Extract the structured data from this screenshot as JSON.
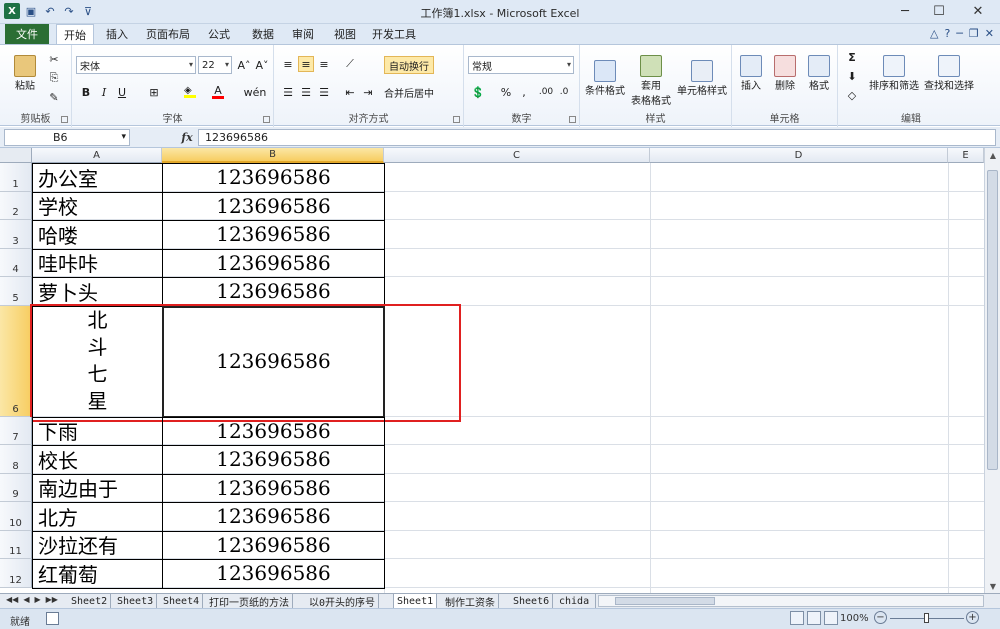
{
  "window": {
    "title": "工作簿1.xlsx - Microsoft Excel",
    "minimize": "─",
    "maximize": "☐",
    "close": "✕"
  },
  "ribbon_tabs": {
    "file": "文件",
    "tabs": [
      "开始",
      "插入",
      "页面布局",
      "公式",
      "数据",
      "审阅",
      "视图",
      "开发工具"
    ],
    "active": "开始"
  },
  "ribbon": {
    "clipboard": {
      "label": "剪贴板",
      "paste": "粘贴"
    },
    "font": {
      "label": "字体",
      "name": "宋体",
      "size": "22",
      "grow": "A˄",
      "shrink": "A˅",
      "bold": "B",
      "italic": "I",
      "underline": "U",
      "fill_color": "#ffff00",
      "font_color": "#ff0000",
      "phonetic": "wén"
    },
    "alignment": {
      "label": "对齐方式",
      "wrap": "自动换行",
      "merge": "合并后居中"
    },
    "number": {
      "label": "数字",
      "format": "常规",
      "percent": "%",
      "comma": ",",
      "inc_decimal": ".00",
      "dec_decimal": ".0"
    },
    "styles": {
      "label": "样式",
      "conditional": "条件格式",
      "table_line1": "套用",
      "table_line2": "表格格式",
      "cell_styles": "单元格样式"
    },
    "cells": {
      "label": "单元格",
      "insert": "插入",
      "delete": "删除",
      "format": "格式"
    },
    "editing": {
      "label": "编辑",
      "sort": "排序和筛选",
      "find": "查找和选择",
      "sum": "Σ"
    }
  },
  "formula_bar": {
    "name_box": "B6",
    "fx": "fx",
    "content": "123696586"
  },
  "columns": [
    "A",
    "B",
    "C",
    "D",
    "E"
  ],
  "rows": [
    {
      "num": "1",
      "a": "办公室",
      "b": "123696586"
    },
    {
      "num": "2",
      "a": "学校",
      "b": "123696586"
    },
    {
      "num": "3",
      "a": "哈喽",
      "b": "123696586"
    },
    {
      "num": "4",
      "a": "哇咔咔",
      "b": "123696586"
    },
    {
      "num": "5",
      "a": "萝卜头",
      "b": "123696586"
    },
    {
      "num": "6",
      "a_lines": [
        "北",
        "斗",
        "七",
        "星"
      ],
      "b": "123696586"
    },
    {
      "num": "7",
      "a": "下雨",
      "b": "123696586"
    },
    {
      "num": "8",
      "a": "校长",
      "b": "123696586"
    },
    {
      "num": "9",
      "a": "南边由于",
      "b": "123696586"
    },
    {
      "num": "10",
      "a": "北方",
      "b": "123696586"
    },
    {
      "num": "11",
      "a": "沙拉还有",
      "b": "123696586"
    },
    {
      "num": "12",
      "a": "红葡萄",
      "b": "123696586"
    }
  ],
  "selected_cell": "B6",
  "sheet_tabs": [
    "Sheet2",
    "Sheet3",
    "Sheet4",
    "打印一页纸的方法",
    "以0开头的序号",
    "Sheet1",
    "制作工资条",
    "Sheet6",
    "chida"
  ],
  "active_sheet": "Sheet1",
  "status": {
    "ready": "就绪",
    "zoom": "100%",
    "zoom_minus": "−",
    "zoom_plus": "+"
  },
  "colors": {
    "file_tab": "#2b6e34",
    "highlight": "#e02020",
    "selected_header": "#f7cd61"
  }
}
